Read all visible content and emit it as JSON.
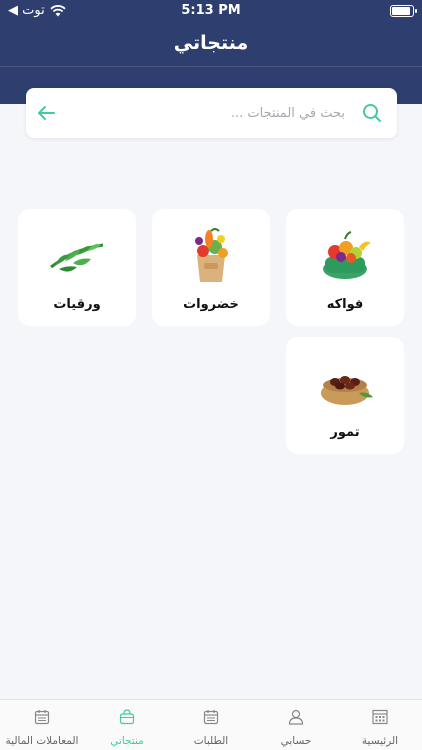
{
  "status": {
    "back_app": "◀ توت",
    "time": "5:13 PM",
    "battery_level": 0.95
  },
  "header": {
    "title": "منتجاتي"
  },
  "search": {
    "placeholder": "بحث في المنتجات ...",
    "value": ""
  },
  "categories": [
    {
      "label": "فواكه",
      "icon": "fruits-basket-image"
    },
    {
      "label": "خضروات",
      "icon": "vegetables-bag-image"
    },
    {
      "label": "ورقيات",
      "icon": "leafy-greens-image"
    },
    {
      "label": "تمور",
      "icon": "dates-bowl-image"
    }
  ],
  "tabbar": {
    "items": [
      {
        "label": "الرئيسية",
        "icon": "home-grid-icon",
        "active": false
      },
      {
        "label": "حسابي",
        "icon": "user-icon",
        "active": false
      },
      {
        "label": "الطلبات",
        "icon": "orders-calendar-icon",
        "active": false
      },
      {
        "label": "منتجاتي",
        "icon": "products-basket-icon",
        "active": true
      },
      {
        "label": "المعاملات المالية",
        "icon": "transactions-calendar-icon",
        "active": false
      }
    ]
  },
  "colors": {
    "header": "#2e3e6e",
    "accent": "#45c9a5",
    "background": "#f5f6fa"
  }
}
